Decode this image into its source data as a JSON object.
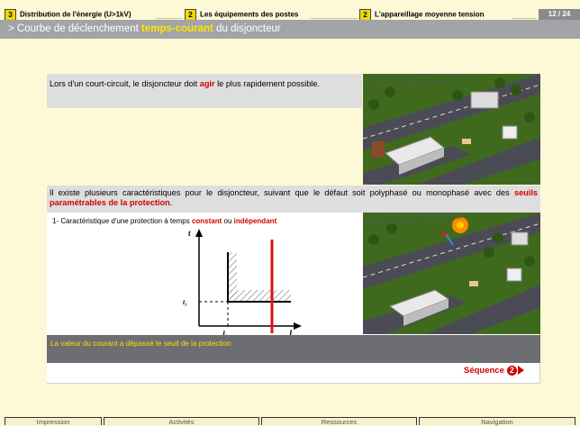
{
  "breadcrumb": [
    {
      "num": "3",
      "label": "Distribution de l'énergie (U>1kV)"
    },
    {
      "num": "2",
      "label": "Les équipements des postes"
    },
    {
      "num": "2",
      "label": "L'appareillage moyenne tension"
    }
  ],
  "page_number": "12 / 24",
  "title": {
    "prefix": "> Courbe de déclenchement ",
    "highlight": "temps-courant",
    "suffix": " du disjoncteur"
  },
  "intro": {
    "part1": "Lors d'un court-circuit, le disjoncteur doit ",
    "emph": "agir",
    "part2": " le plus rapidement possible."
  },
  "explanation": {
    "part1": "Il existe plusieurs caractéristiques pour le disjoncteur, suivant que le défaut soit polyphasé ou monophasé avec des ",
    "emph": "seuils paramétrables de la protection",
    "part2": "."
  },
  "characteristic": {
    "prefix": "1- Caractéristique d'une protection à temps ",
    "emph1": "constant",
    "mid": " ou ",
    "emph2": "indépendant"
  },
  "graph": {
    "t_axis": "t",
    "i_axis": "I",
    "t1_label": "t₁",
    "i1_label": "I₁"
  },
  "status_message": "La valeur du courant a dépassé le seuil de la protection",
  "sequence": {
    "label": "Séquence",
    "number": "2"
  },
  "bottom_nav": [
    "Impression",
    "Activités",
    "Ressources",
    "Navigation"
  ],
  "colors": {
    "accent_red": "#d10000",
    "title_highlight": "#ffe600",
    "badge_yellow": "#f0d800"
  }
}
